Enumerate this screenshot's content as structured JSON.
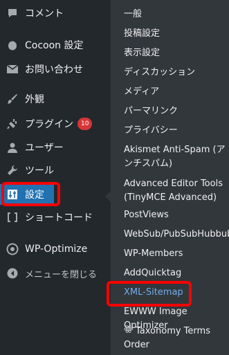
{
  "sidebar": {
    "items": [
      {
        "label": "コメント",
        "icon": "comment-icon"
      },
      {
        "label": "Cocoon 設定",
        "icon": "cocoon-icon"
      },
      {
        "label": "お問い合わせ",
        "icon": "mail-icon"
      },
      {
        "label": "外観",
        "icon": "paintbrush-icon"
      },
      {
        "label": "プラグイン",
        "icon": "plugin-icon",
        "badge": "10"
      },
      {
        "label": "ユーザー",
        "icon": "user-icon"
      },
      {
        "label": "ツール",
        "icon": "wrench-icon"
      },
      {
        "label": "設定",
        "icon": "settings-icon",
        "active": true
      },
      {
        "label": "ショートコード",
        "icon": "shortcode-icon"
      },
      {
        "label": "WP-Optimize",
        "icon": "wp-optimize-icon"
      },
      {
        "label": "メニューを閉じる",
        "icon": "collapse-icon"
      }
    ]
  },
  "submenu": {
    "items": [
      {
        "label": "一般"
      },
      {
        "label": "投稿設定"
      },
      {
        "label": "表示設定"
      },
      {
        "label": "ディスカッション"
      },
      {
        "label": "メディア"
      },
      {
        "label": "パーマリンク"
      },
      {
        "label": "プライバシー"
      },
      {
        "label": "Akismet Anti-Spam (アンチスパム)"
      },
      {
        "label": "Advanced Editor Tools (TinyMCE Advanced)"
      },
      {
        "label": "PostViews"
      },
      {
        "label": "WebSub/PubSubHubbub"
      },
      {
        "label": "WP-Members"
      },
      {
        "label": "AddQuicktag"
      },
      {
        "label": "XML-Sitemap",
        "current": true
      },
      {
        "label": "EWWW Image Optimizer"
      },
      {
        "label": "Taxonomy Terms Order",
        "icon": "atom-icon"
      }
    ]
  },
  "colors": {
    "sidebar_bg": "#23282d",
    "flyout_bg": "#32373c",
    "active_bg": "#2271b1",
    "badge_bg": "#d63638",
    "highlight_border": "#ff0000",
    "current_link": "#72aee6"
  }
}
